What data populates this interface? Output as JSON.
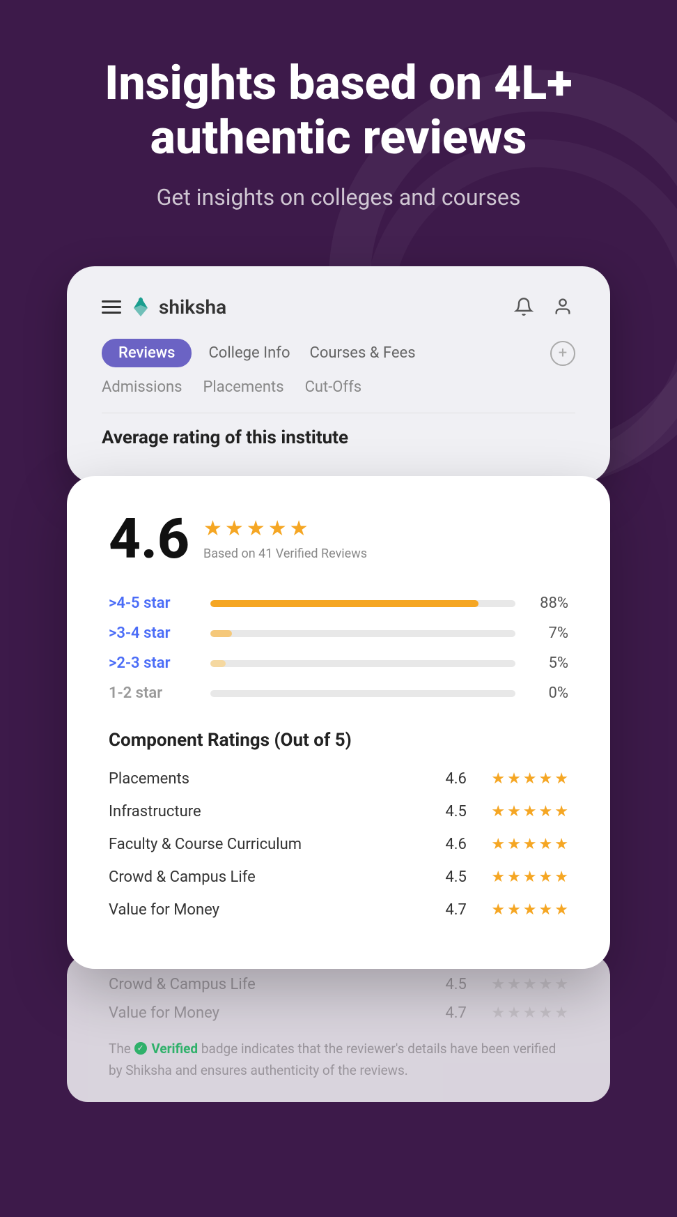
{
  "hero": {
    "title": "Insights based on 4L+ authentic reviews",
    "subtitle": "Get insights on colleges and courses"
  },
  "app": {
    "logo_text": "shiksha",
    "tabs_row1": [
      "Reviews",
      "College Info",
      "Courses & Fees"
    ],
    "tabs_row2": [
      "Admissions",
      "Placements",
      "Cut-Offs"
    ],
    "tab_active": "Reviews"
  },
  "rating_section": {
    "heading": "Average rating of this institute",
    "score": "4.6",
    "based_on": "Based on 41 Verified Reviews",
    "bars": [
      {
        "label": ">4-5 star",
        "pct": "88%",
        "fill": 88,
        "type": "orange"
      },
      {
        "label": ">3-4 star",
        "pct": "7%",
        "fill": 7,
        "type": "light-orange"
      },
      {
        "label": ">2-3 star",
        "pct": "5%",
        "fill": 5,
        "type": "lighter"
      },
      {
        "label": "1-2 star",
        "pct": "0%",
        "fill": 0,
        "type": "grey-fill"
      }
    ],
    "component_title": "Component Ratings (Out of 5)",
    "components": [
      {
        "name": "Placements",
        "score": "4.6",
        "stars": 4.5
      },
      {
        "name": "Infrastructure",
        "score": "4.5",
        "stars": 4.5
      },
      {
        "name": "Faculty & Course Curriculum",
        "score": "4.6",
        "stars": 4.5
      },
      {
        "name": "Crowd & Campus Life",
        "score": "4.5",
        "stars": 4.5
      },
      {
        "name": "Value for Money",
        "score": "4.7",
        "stars": 5
      }
    ],
    "blur_components": [
      {
        "name": "Crowd & Campus Life",
        "score": "4.5"
      },
      {
        "name": "Value for Money",
        "score": "4.7"
      }
    ],
    "verified_text_prefix": "The ",
    "verified_word": "Verified",
    "verified_text_suffix": " badge indicates that the reviewer's details have been verified by Shiksha and ensures authenticity of the reviews."
  }
}
